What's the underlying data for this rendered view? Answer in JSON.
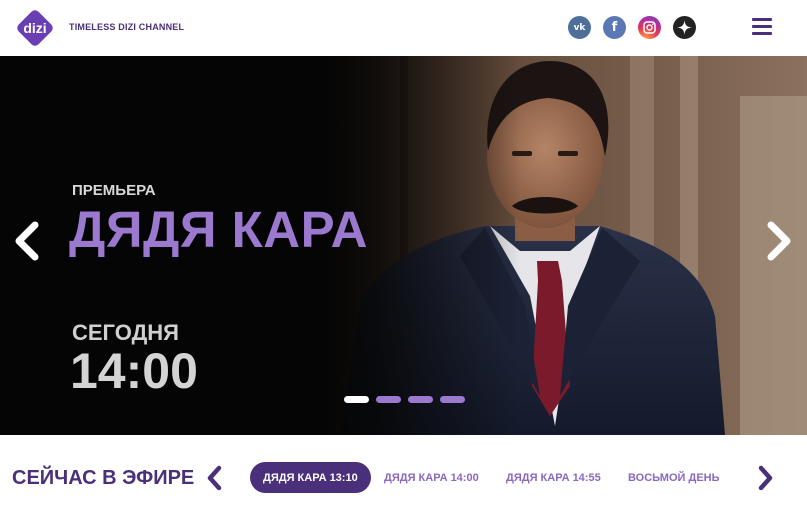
{
  "header": {
    "logo_text": "dizi",
    "tagline": "TIMELESS DIZI CHANNEL",
    "social": [
      {
        "name": "vk-icon",
        "glyph": "vk",
        "color": "#4d6f9a"
      },
      {
        "name": "facebook-icon",
        "glyph": "f",
        "color": "#5b78b5"
      },
      {
        "name": "instagram-icon",
        "glyph": "",
        "color": "#c13584"
      },
      {
        "name": "zen-icon",
        "glyph": "",
        "color": "#222222"
      }
    ],
    "menu_icon": "hamburger-icon"
  },
  "hero": {
    "kicker": "ПРЕМЬЕРА",
    "title": "ДЯДЯ КАРА",
    "day": "СЕГОДНЯ",
    "time": "14:00",
    "slides_total": 4,
    "active_slide": 1,
    "prev_icon": "chevron-left-icon",
    "next_icon": "chevron-right-icon"
  },
  "on_air": {
    "title": "СЕЙЧАС В ЭФИРЕ",
    "items": [
      {
        "label": "ДЯДЯ КАРА 13:10",
        "active": true
      },
      {
        "label": "ДЯДЯ КАРА 14:00",
        "active": false
      },
      {
        "label": "ДЯДЯ КАРА 14:55",
        "active": false
      },
      {
        "label": "ВОСЬМОЙ ДЕНЬ",
        "active": false
      }
    ]
  },
  "colors": {
    "brand_purple": "#4a2f7a",
    "accent_lavender": "#9b79cf",
    "hero_bg": "#050505"
  }
}
